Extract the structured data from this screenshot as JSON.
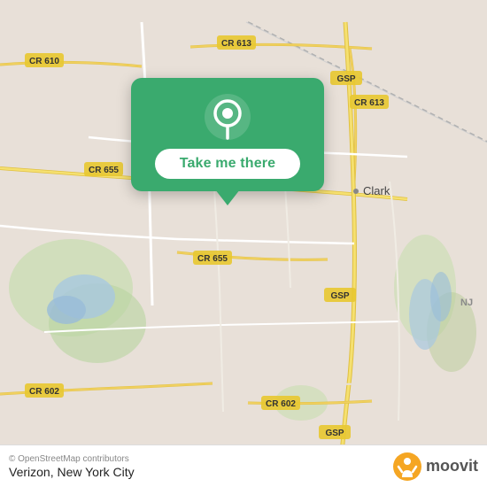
{
  "map": {
    "attribution": "© OpenStreetMap contributors",
    "bg_color": "#e8e0d8",
    "road_color": "#f5f0e8",
    "road_yellow": "#f0d060",
    "road_white": "#ffffff",
    "water_color": "#b8d4e8",
    "green_color": "#c8e0b0"
  },
  "popup": {
    "bg_color": "#3aaa6e",
    "button_label": "Take me there",
    "button_text_color": "#3aaa6e"
  },
  "bottom_bar": {
    "attribution": "© OpenStreetMap contributors",
    "location_name": "Verizon, New York City",
    "brand": "moovit"
  },
  "labels": {
    "cr610": "CR 610",
    "cr613_top": "CR 613",
    "cr613_right": "CR 613",
    "cr655_left": "CR 655",
    "cr655_bottom": "CR 655",
    "cr602_left": "CR 602",
    "cr602_bottom": "CR 602",
    "gsp_top": "GSP",
    "gsp_mid": "GSP",
    "clark": "Clark"
  }
}
